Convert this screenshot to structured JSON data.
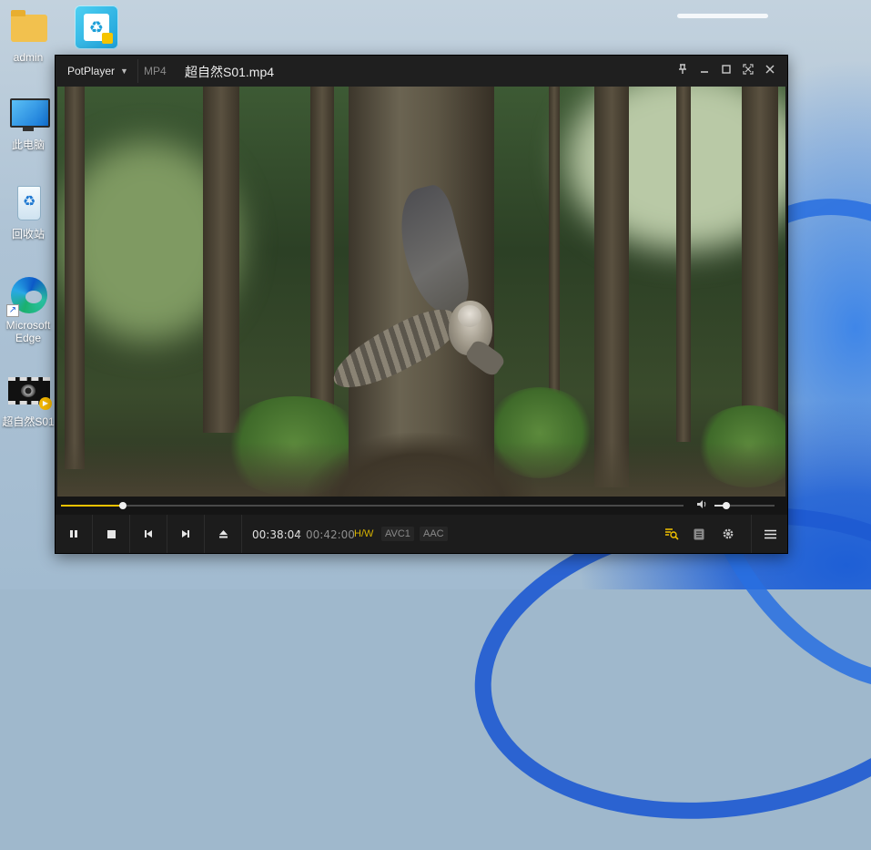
{
  "desktop": {
    "icons": [
      {
        "label": "admin"
      },
      {
        "label": "此电脑"
      },
      {
        "label": "回收站"
      },
      {
        "label": "Microsoft Edge"
      },
      {
        "label": "超自然S01"
      }
    ]
  },
  "player": {
    "brand": "PotPlayer",
    "format": "MP4",
    "filename": "超自然S01.mp4",
    "progress_fraction": 0.1,
    "volume_fraction": 0.2,
    "time_current": "00:38:04",
    "time_separator": "/",
    "time_total": "00:42:00",
    "tags": {
      "hw": "H/W",
      "video_codec": "AVC1",
      "audio_codec": "AAC"
    }
  },
  "colors": {
    "accent": "#f2c200",
    "titlebar": "#1f1f1f",
    "controls": "#1c1c1c"
  }
}
